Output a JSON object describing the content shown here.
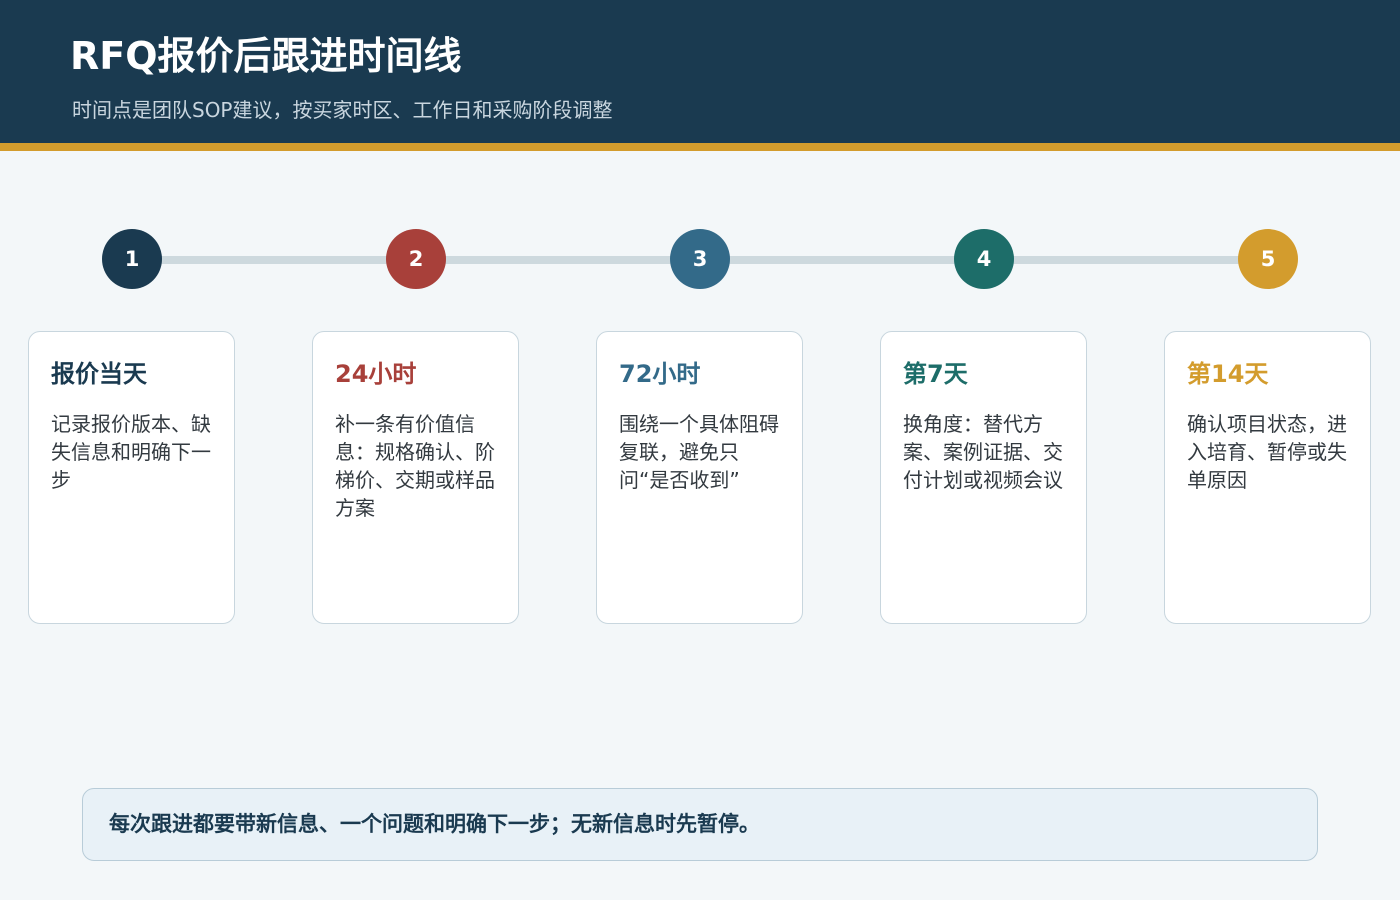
{
  "header": {
    "title": "RFQ报价后跟进时间线",
    "subtitle": "时间点是团队SOP建议，按买家时区、工作日和采购阶段调整"
  },
  "steps": [
    {
      "number": "1",
      "title": "报价当天",
      "text": "记录报价版本、缺失信息和明确下一步",
      "color": "#1a3a50"
    },
    {
      "number": "2",
      "title": "24小时",
      "text": "补一条有价值信息：规格确认、阶梯价、交期或样品方案",
      "color": "#a8403a"
    },
    {
      "number": "3",
      "title": "72小时",
      "text": "围绕一个具体阻碍复联，避免只问“是否收到”",
      "color": "#336a89"
    },
    {
      "number": "4",
      "title": "第7天",
      "text": "换角度：替代方案、案例证据、交付计划或视频会议",
      "color": "#1d6d69"
    },
    {
      "number": "5",
      "title": "第14天",
      "text": "确认项目状态，进入培育、暂停或失单原因",
      "color": "#d39c2d"
    }
  ],
  "note": {
    "text": "每次跟进都要带新信息、一个问题和明确下一步；无新信息时先暂停。"
  },
  "colors": {
    "header_bg": "#1a3a50",
    "accent": "#d39c2d",
    "track": "#cdd9de",
    "page_bg": "#f3f7f9"
  }
}
